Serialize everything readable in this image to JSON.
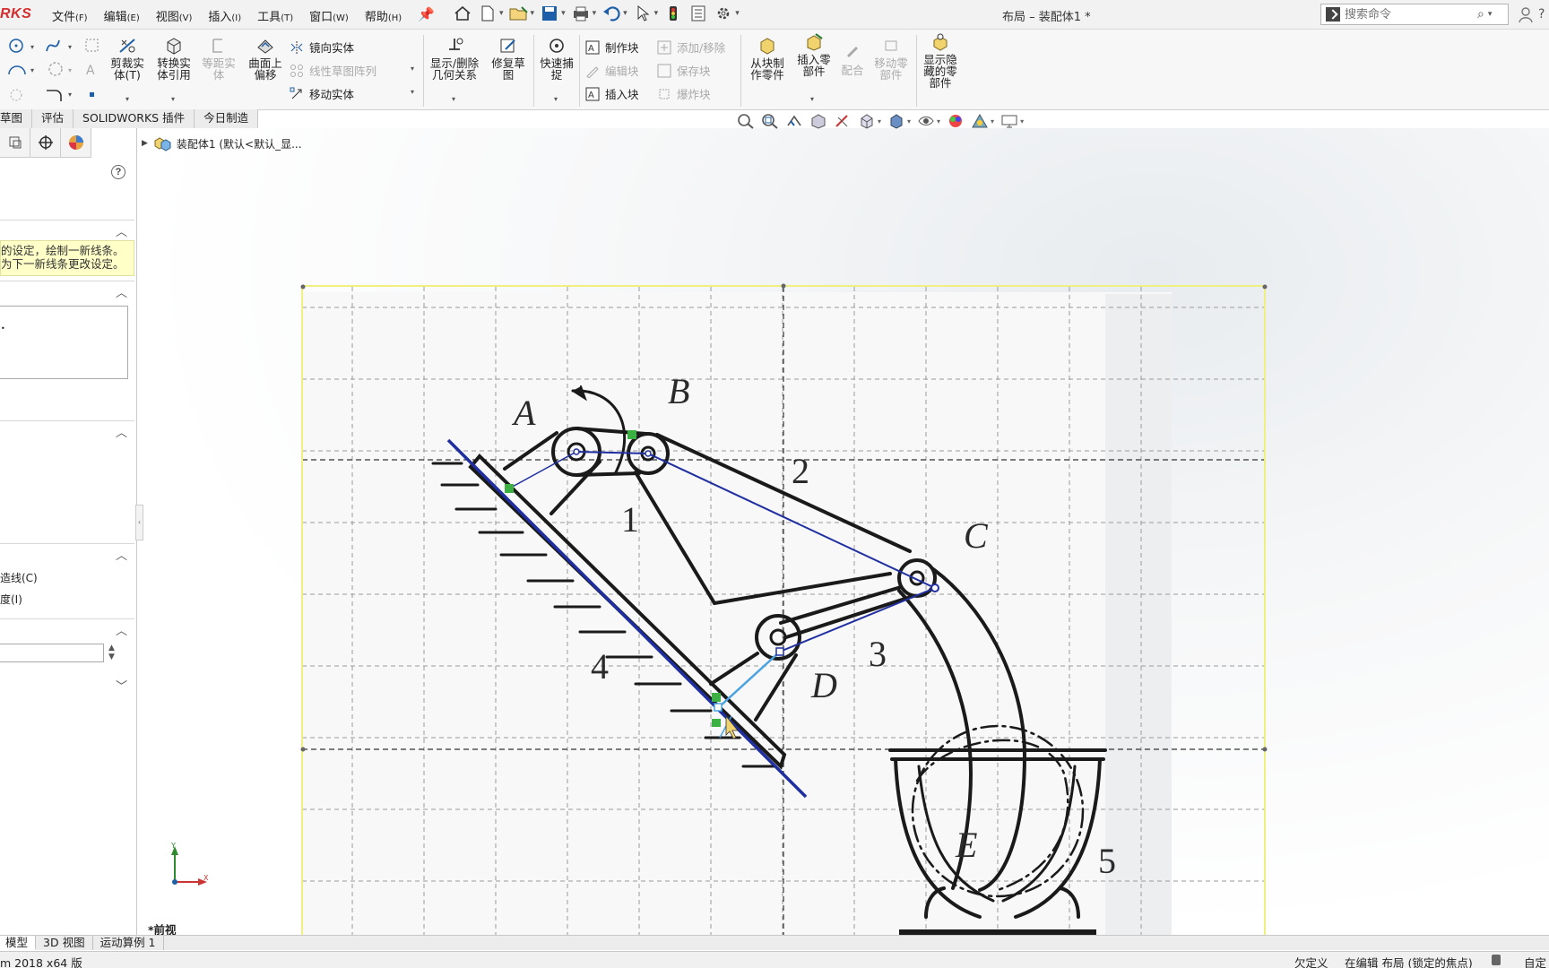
{
  "app": {
    "logo_text": "RKS",
    "document_title": "布局 – 装配体1 *",
    "version_text": "m 2018 x64 版"
  },
  "menu": [
    {
      "label": "文件",
      "key": "(F)"
    },
    {
      "label": "编辑",
      "key": "(E)"
    },
    {
      "label": "视图",
      "key": "(V)"
    },
    {
      "label": "插入",
      "key": "(I)"
    },
    {
      "label": "工具",
      "key": "(T)"
    },
    {
      "label": "窗口",
      "key": "(W)"
    },
    {
      "label": "帮助",
      "key": "(H)"
    }
  ],
  "search": {
    "placeholder": "搜索命令"
  },
  "ribbon": {
    "trim_entities": "剪裁实\n体(T)",
    "convert_entities": "转换实\n体引用",
    "offset_entities": "等距实\n体",
    "offset_on_surface": "曲面上\n偏移",
    "mirror_entities": "镜向实体",
    "linear_pattern": "线性草图阵列",
    "move_entities": "移动实体",
    "display_delete_relations": "显示/删除\n几何关系",
    "repair_sketch": "修复草\n图",
    "rapid_snap": "快速捕\n捉",
    "make_block": "制作块",
    "edit_block": "编辑块",
    "insert_block": "插入块",
    "add_remove": "添加/移除",
    "save_block": "保存块",
    "explode_block": "爆炸块",
    "make_part_from_block": "从块制\n作零件",
    "insert_part": "插入零\n部件",
    "mate": "配合",
    "move_component": "移动零\n部件",
    "show_hidden": "显示隐\n藏的零\n部件"
  },
  "command_tabs": [
    "草图",
    "评估",
    "SOLIDWORKS 插件",
    "今日制造"
  ],
  "left_panel": {
    "message_line1": "的设定，绘制一新线条。",
    "message_line2": "为下一新线条更改设定。",
    "option1": "造线(C)",
    "option2": "度(I)",
    "numeric_value": ""
  },
  "tree": {
    "root_label": "装配体1  (默认<默认_显..."
  },
  "graphics": {
    "view_label": "*前视",
    "triad": {
      "x": "X",
      "y": "Y"
    },
    "labels": {
      "A": "A",
      "B": "B",
      "C": "C",
      "D": "D",
      "E": "E"
    },
    "numbers": {
      "n1": "1",
      "n2": "2",
      "n3": "3",
      "n4": "4",
      "n5": "5"
    }
  },
  "bottom_tabs": [
    "模型",
    "3D 视图",
    "运动算例 1"
  ],
  "status": {
    "defined": "欠定义",
    "editing": "在编辑 布局 (锁定的焦点)",
    "mode": "自定"
  },
  "colors": {
    "sketch_line": "#1f2fa0",
    "highlight_line": "#4aa3df",
    "relation_marker": "#3cb043",
    "sketch_border": "#f0f080",
    "logo": "#d32f2f"
  }
}
